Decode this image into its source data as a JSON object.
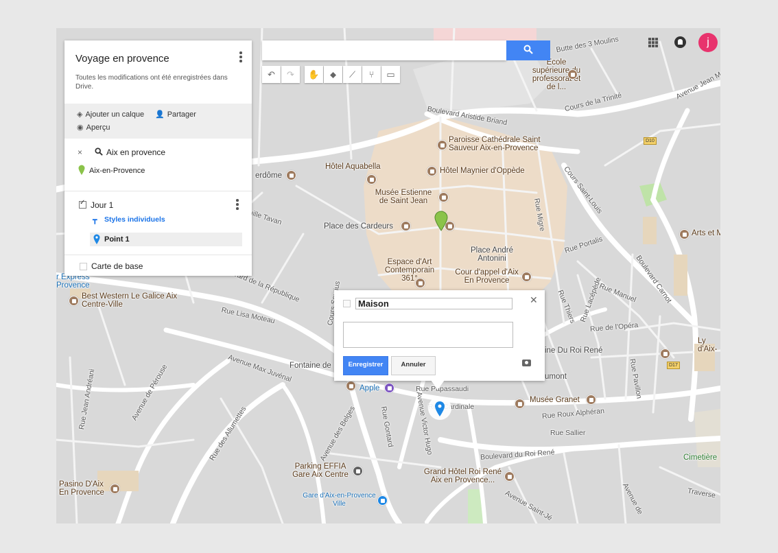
{
  "app": {
    "map_title": "Voyage en provence",
    "save_status": "Toutes les modifications ont été enregistrées dans Drive.",
    "avatar_initial": "j"
  },
  "actions": {
    "add_layer": "Ajouter un calque",
    "share": "Partager",
    "preview": "Aperçu"
  },
  "search_layer": {
    "query": "Aix en provence",
    "result": "Aix-en-Provence"
  },
  "layer": {
    "name": "Jour 1",
    "style": "Styles individuels",
    "point": "Point 1"
  },
  "base_map": "Carte de base",
  "popup": {
    "title": "Maison",
    "description": "",
    "save": "Enregistrer",
    "cancel": "Annuler"
  },
  "map_labels": {
    "l01": "Butte des 3 Moulins",
    "l02": "École supérieure du professorat et de l...",
    "l03": "Avenue Jean M",
    "l04": "Cours de la Trinité",
    "l05": "Boulevard Aristide Briand",
    "l06": "Paroisse Cathédrale Saint Sauveur Aix-en-Provence",
    "l07": "D10",
    "l08": "Hôtel Aquabella",
    "l09": "Hôtel Maynier d'Oppède",
    "l10": "Cours Saint-Louis",
    "l11": "erdôme",
    "l12": "Musée Estienne de Saint Jean",
    "l13": "Rue Migre",
    "l14": "Arts et M",
    "l15": "Place des Cardeurs",
    "l16": "uille Tavan",
    "l17": "Rue Portalis",
    "l18": "Place André Antonini",
    "l19": "Boulevard Carnot",
    "l20": "Espace d'Art Contemporain 361°",
    "l21": "Cour d'appel d'Aix En Provence",
    "l22": "r Express Provence",
    "l23": "evard de la République",
    "l24": "Best Western Le Galice Aix Centre-Ville",
    "l25": "Rue Manuel",
    "l26": "Rue Lacépède",
    "l27": "Rue Thiers",
    "l28": "Rue Lisa Moteau",
    "l29": "Cours Sextius",
    "l30": "Rue de l'Opéra",
    "l31": "ine Du Roi René",
    "l32": "Ly d'Aix-",
    "l33": "Fontaine de",
    "l34": "Avenue Max Juvénal",
    "l35": "D17",
    "l36": "Rue Jean Andréani",
    "l37": "Avenue de Pérouse",
    "l38": "Apple",
    "l39": "Rue Papassaudi",
    "l40": "umont",
    "l41": "Rue Pavillon",
    "l42": "Musée Granet",
    "l43": "Rue Roux Alphéran",
    "l44": "Rue Sallier",
    "l45": "Rue des Allumettes",
    "l46": "Avenue des Belges",
    "l47": "Rue Gontard",
    "l48": "Avenue Victor Hugo",
    "l49": "Boulevard du Roi René",
    "l50": "Cimetière",
    "l51": "Parking EFFIA Gare Aix Centre",
    "l52": "Grand Hôtel Roi René Aix en Provence...",
    "l53": "Pasino D'Aix En Provence",
    "l54": "Gare d'Aix-en-Provence Ville",
    "l55": "Traverse",
    "l56": "Avenue Saint-Jé",
    "l57": "Avenue de",
    "l58": "Rue Cardinale"
  },
  "colors": {
    "accent": "#4285f4",
    "avatar": "#e8336d",
    "marker_green": "#8bc34a",
    "marker_blue": "#1e88e5",
    "old_town": "#eddcc8",
    "map_bg": "#d9d9d9"
  },
  "icons": [
    "search-icon",
    "undo-icon",
    "redo-icon",
    "hand-icon",
    "marker-icon",
    "line-icon",
    "route-icon",
    "ruler-icon",
    "apps-icon",
    "notifications-icon",
    "more-vert-icon",
    "layers-icon",
    "person-add-icon",
    "eye-icon",
    "close-icon",
    "paint-icon",
    "camera-icon"
  ]
}
